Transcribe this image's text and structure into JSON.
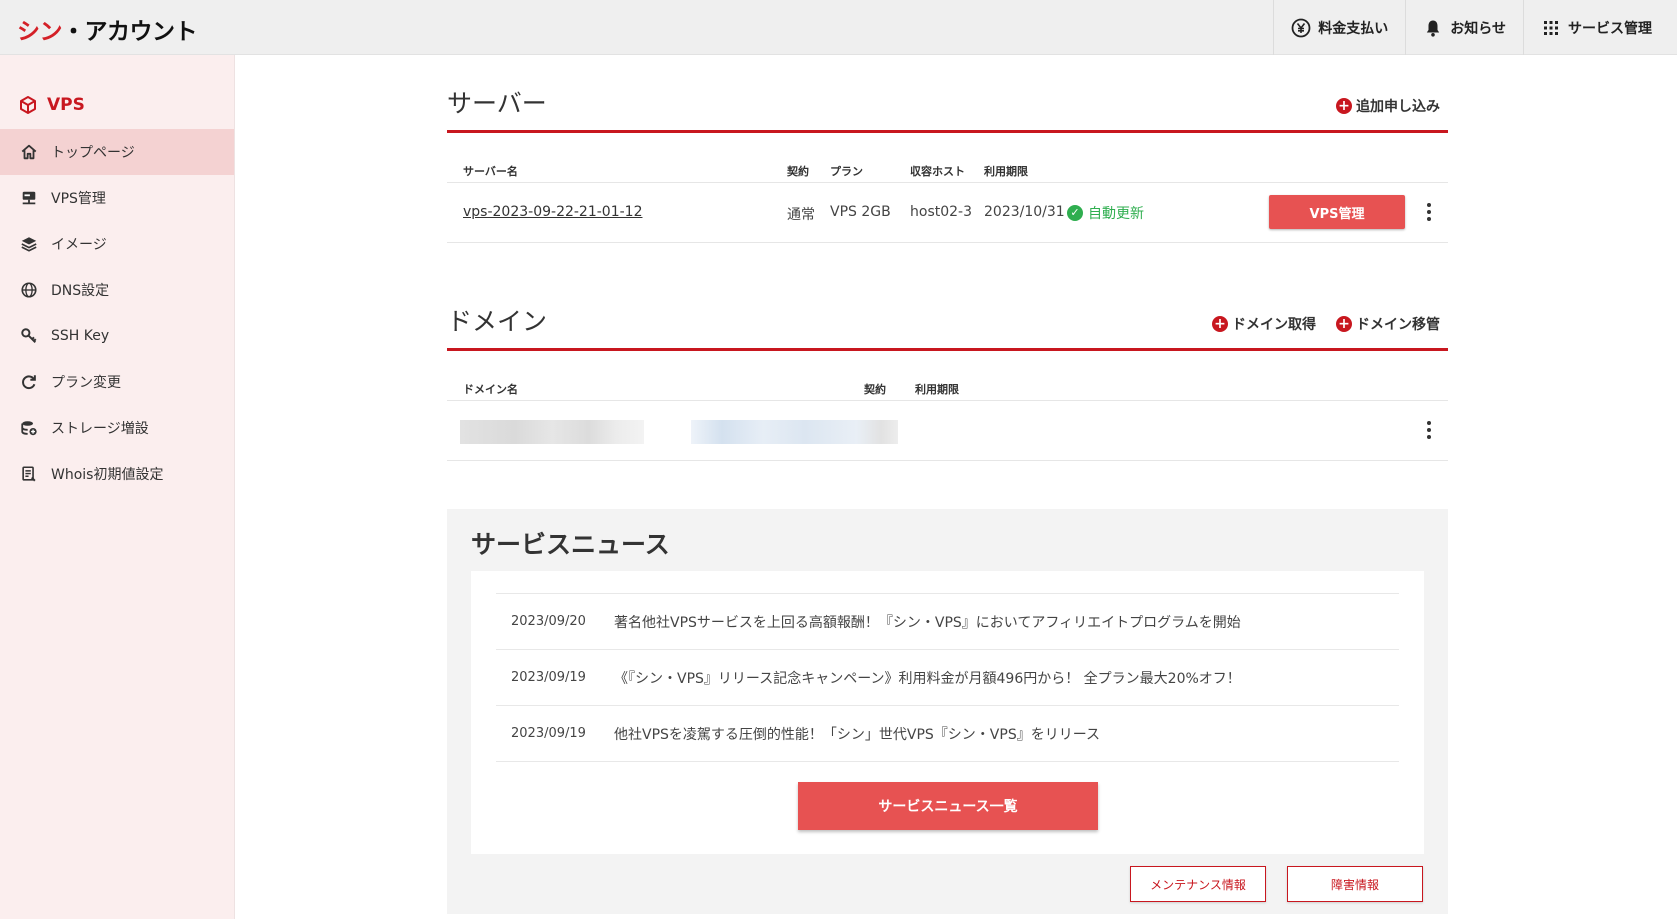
{
  "brand": {
    "part1": "シン",
    "part2": "・アカウント"
  },
  "top_nav": {
    "billing": "料金支払い",
    "notifications": "お知らせ",
    "services": "サービス管理"
  },
  "sidebar": {
    "title": "VPS",
    "items": [
      {
        "label": "トップページ",
        "icon": "home-icon",
        "active": true
      },
      {
        "label": "VPS管理",
        "icon": "server-icon"
      },
      {
        "label": "イメージ",
        "icon": "layers-icon"
      },
      {
        "label": "DNS設定",
        "icon": "globe-icon"
      },
      {
        "label": "SSH Key",
        "icon": "key-icon"
      },
      {
        "label": "プラン変更",
        "icon": "refresh-icon"
      },
      {
        "label": "ストレージ増設",
        "icon": "storage-icon"
      },
      {
        "label": "Whois初期値設定",
        "icon": "document-icon"
      }
    ]
  },
  "server": {
    "title": "サーバー",
    "add_label": "追加申し込み",
    "columns": {
      "name": "サーバー名",
      "contract": "契約",
      "plan": "プラン",
      "host": "収容ホスト",
      "expiry": "利用期限"
    },
    "row": {
      "name": "vps-2023-09-22-21-01-12",
      "contract": "通常",
      "plan": "VPS 2GB",
      "host": "host02-3",
      "expiry": "2023/10/31",
      "renew": "自動更新",
      "manage_label": "VPS管理"
    }
  },
  "domain": {
    "title": "ドメイン",
    "acquire_label": "ドメイン取得",
    "transfer_label": "ドメイン移管",
    "columns": {
      "name": "ドメイン名",
      "contract": "契約",
      "expiry": "利用期限"
    }
  },
  "news": {
    "title": "サービスニュース",
    "items": [
      {
        "date": "2023/09/20",
        "text": "著名他社VPSサービスを上回る高額報酬！『シン・VPS』においてアフィリエイトプログラムを開始"
      },
      {
        "date": "2023/09/19",
        "text": "《『シン・VPS』リリース記念キャンペーン》利用料金が月額496円から！ 全プラン最大20%オフ！"
      },
      {
        "date": "2023/09/19",
        "text": "他社VPSを凌駕する圧倒的性能！「シン」世代VPS『シン・VPS』をリリース"
      }
    ],
    "all_label": "サービスニュース一覧",
    "maintenance_label": "メンテナンス情報",
    "incident_label": "障害情報"
  },
  "colors": {
    "accent": "#c8171f",
    "button": "#e75252",
    "success": "#2fae4f",
    "sidebar_bg": "#fbeeee"
  }
}
